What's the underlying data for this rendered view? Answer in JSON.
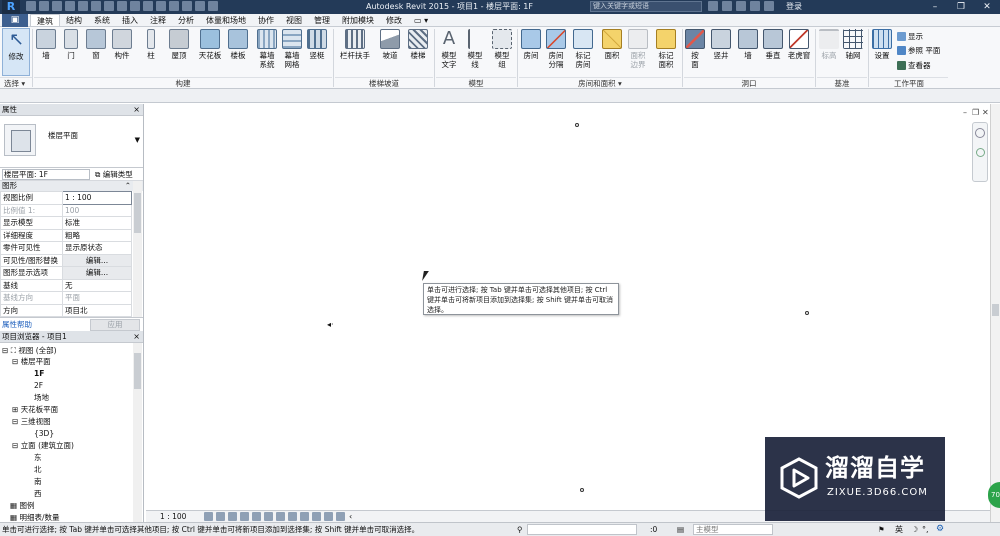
{
  "titlebar": {
    "title": "Autodesk Revit 2015 -   项目1 - 楼层平面: 1F",
    "search_placeholder": "键入关键字或短语",
    "login": "登录",
    "app_letter": "R"
  },
  "tabs": [
    "建筑",
    "结构",
    "系统",
    "插入",
    "注释",
    "分析",
    "体量和场地",
    "协作",
    "视图",
    "管理",
    "附加模块",
    "修改"
  ],
  "active_tab": "建筑",
  "ribbon": {
    "select_button": "修改",
    "select_dropdown": "选择 ▾",
    "build": {
      "buttons": [
        "墙",
        "门",
        "窗",
        "构件",
        "柱",
        "屋顶",
        "天花板",
        "楼板",
        "幕墙\n系统",
        "幕墙\n网格",
        "竖梃"
      ],
      "label": "构建"
    },
    "circulation": {
      "buttons": [
        "栏杆扶手",
        "坡道",
        "楼梯"
      ],
      "label": "楼梯坡道"
    },
    "model": {
      "buttons": [
        "模型\n文字",
        "模型\n线",
        "模型\n组"
      ],
      "label": "模型"
    },
    "room": {
      "buttons": [
        "房间",
        "房间\n分隔",
        "标记\n房间",
        "面积",
        "面积\n边界",
        "标记\n面积"
      ],
      "label": "房间和面积 ▾"
    },
    "opening": {
      "buttons": [
        "按\n面",
        "竖井",
        "墙",
        "垂直",
        "老虎窗"
      ],
      "label": "洞口"
    },
    "datum": {
      "buttons": [
        "标高",
        "轴网"
      ],
      "label": "基准"
    },
    "workplane": {
      "set_button": "设置",
      "small_buttons": [
        "显示",
        "参照 平面",
        "查看器"
      ],
      "label": "工作平面"
    }
  },
  "properties": {
    "panel_title": "属性",
    "close": "×",
    "type_name": "楼层平面",
    "instance_selector": "楼层平面: 1F",
    "edit_type": "编辑类型",
    "category": "图形",
    "rows": [
      {
        "key": "视图比例",
        "value": "1 : 100",
        "dim": false
      },
      {
        "key": "比例值 1:",
        "value": "100",
        "dim": true
      },
      {
        "key": "显示模型",
        "value": "标准",
        "dim": false
      },
      {
        "key": "详细程度",
        "value": "粗略",
        "dim": false
      },
      {
        "key": "零件可见性",
        "value": "显示原状态",
        "dim": false
      },
      {
        "key": "可见性/图形替换",
        "value": "编辑...",
        "dim": false
      },
      {
        "key": "图形显示选项",
        "value": "编辑...",
        "dim": false
      },
      {
        "key": "基线",
        "value": "无",
        "dim": false
      },
      {
        "key": "基线方向",
        "value": "平面",
        "dim": true
      },
      {
        "key": "方向",
        "value": "项目北",
        "dim": false
      }
    ],
    "help": "属性帮助",
    "apply": "应用"
  },
  "browser": {
    "panel_title": "项目浏览器 - 项目1",
    "close": "×",
    "nodes": [
      {
        "label": "视图 (全部)",
        "level": 0,
        "toggle": "⊟",
        "bold": false
      },
      {
        "label": "楼层平面",
        "level": 1,
        "toggle": "⊟",
        "bold": false
      },
      {
        "label": "1F",
        "level": 2,
        "toggle": "",
        "bold": true
      },
      {
        "label": "2F",
        "level": 2,
        "toggle": "",
        "bold": false
      },
      {
        "label": "场地",
        "level": 2,
        "toggle": "",
        "bold": false
      },
      {
        "label": "天花板平面",
        "level": 1,
        "toggle": "⊞",
        "bold": false
      },
      {
        "label": "三维视图",
        "level": 1,
        "toggle": "⊟",
        "bold": false
      },
      {
        "label": "{3D}",
        "level": 2,
        "toggle": "",
        "bold": false
      },
      {
        "label": "立面 (建筑立面)",
        "level": 1,
        "toggle": "⊟",
        "bold": false
      },
      {
        "label": "东",
        "level": 2,
        "toggle": "",
        "bold": false
      },
      {
        "label": "北",
        "level": 2,
        "toggle": "",
        "bold": false
      },
      {
        "label": "南",
        "level": 2,
        "toggle": "",
        "bold": false
      },
      {
        "label": "西",
        "level": 2,
        "toggle": "",
        "bold": false
      },
      {
        "label": "图例",
        "level": 0,
        "toggle": "",
        "bold": false
      },
      {
        "label": "明细表/数量",
        "level": 0,
        "toggle": "",
        "bold": false
      }
    ]
  },
  "canvas": {
    "tooltip": "单击可进行选择; 按 Tab 键并单击可选择其他项目; 按 Ctrl 键并单击可将新项目添加到选择集; 按 Shift 键并单击可取消选择。"
  },
  "view_control": {
    "scale": "1 : 100"
  },
  "statusbar": {
    "message": "单击可进行选择; 按 Tab 键并单击可选择其他项目; 按 Ctrl 键并单击可将新项目添加到选择集; 按 Shift 键并单击可取消选择。",
    "zero": ":0",
    "model": "主模型",
    "ime": "英"
  },
  "watermark": {
    "title": "溜溜自学",
    "url": "ZIXUE.3D66.COM"
  },
  "badge": "70"
}
